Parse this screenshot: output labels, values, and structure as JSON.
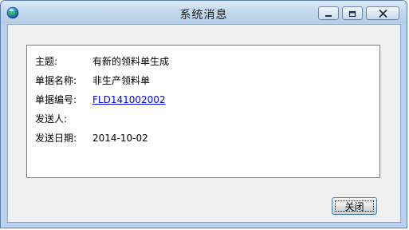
{
  "window": {
    "title": "系统消息"
  },
  "message": {
    "subject_label": "主题:",
    "subject_value": "有新的领料单生成",
    "doc_name_label": "单据名称:",
    "doc_name_value": "非生产领料单",
    "doc_number_label": "单据编号:",
    "doc_number_value": "FLD141002002",
    "sender_label": "发送人:",
    "sender_value": "",
    "send_date_label": "发送日期:",
    "send_date_value": "2014-10-02"
  },
  "actions": {
    "close_label": "关闭"
  },
  "colors": {
    "link": "#0000ee",
    "titlebar": "#c3d8ee",
    "client_bg": "#f0f0f0"
  },
  "icons": {
    "app": "globe-icon",
    "minimize": "minimize-icon",
    "maximize": "maximize-icon",
    "close": "close-icon"
  }
}
